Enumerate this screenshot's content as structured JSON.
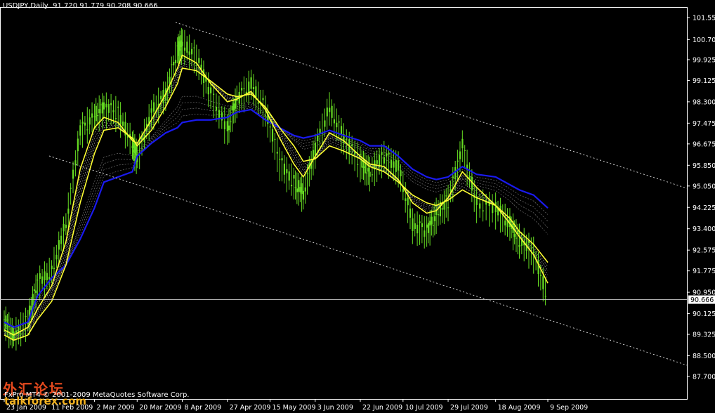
{
  "header": {
    "symbol": "USDJPY,Daily",
    "ohlc": "91.720 91.779 90.208 90.666"
  },
  "footer": {
    "copyright": "FxPro MT4 © 2001-2009 MetaQuotes Software Corp.",
    "watermark_cn": "外汇论坛",
    "watermark_en": "talkforex.com"
  },
  "colors": {
    "background": "#000000",
    "axis": "#ffffff",
    "candles": "#66dd22",
    "ma_yellow": "#ffff33",
    "ma_blue": "#1a1aee",
    "ribbon": "#ffffff"
  },
  "chart_data": {
    "type": "line",
    "title": "USDJPY,Daily",
    "current_price": 90.666,
    "ylim": [
      87.7,
      101.55
    ],
    "y_ticks": [
      101.55,
      100.7,
      99.925,
      99.125,
      98.3,
      97.475,
      96.675,
      95.85,
      95.05,
      94.225,
      93.4,
      92.575,
      91.775,
      90.95,
      90.125,
      89.325,
      88.5,
      87.7
    ],
    "y_tick_labels": [
      "101.550",
      "100.700",
      "99.925",
      "99.125",
      "98.300",
      "97.475",
      "96.675",
      "95.850",
      "95.050",
      "94.225",
      "93.400",
      "92.575",
      "91.775",
      "90.950",
      "90.125",
      "89.325",
      "88.500",
      "87.700"
    ],
    "x_dates": [
      "2009-01-23",
      "2009-01-27",
      "2009-02-02",
      "2009-02-06",
      "2009-02-12",
      "2009-02-18",
      "2009-02-24",
      "2009-03-02",
      "2009-03-06",
      "2009-03-12",
      "2009-03-18",
      "2009-03-20",
      "2009-03-26",
      "2009-04-01",
      "2009-04-06",
      "2009-04-08",
      "2009-04-14",
      "2009-04-20",
      "2009-04-27",
      "2009-05-01",
      "2009-05-07",
      "2009-05-13",
      "2009-05-19",
      "2009-05-25",
      "2009-05-29",
      "2009-06-03",
      "2009-06-09",
      "2009-06-15",
      "2009-06-22",
      "2009-06-26",
      "2009-07-02",
      "2009-07-08",
      "2009-07-14",
      "2009-07-20",
      "2009-07-24",
      "2009-07-29",
      "2009-08-04",
      "2009-08-10",
      "2009-08-18",
      "2009-08-24",
      "2009-08-28",
      "2009-09-03",
      "2009-09-09"
    ],
    "x_tick_labels": [
      "23 Jan 2009",
      "11 Feb 2009",
      "2 Mar 2009",
      "20 Mar 2009",
      "8 Apr 2009",
      "27 Apr 2009",
      "15 May 2009",
      "3 Jun 2009",
      "22 Jun 2009",
      "10 Jul 2009",
      "29 Jul 2009",
      "18 Aug 2009",
      "9 Sep 2009"
    ],
    "series": [
      {
        "key": "close",
        "values": [
          89.9,
          89.3,
          89.9,
          91.3,
          91.8,
          93.6,
          97.2,
          97.8,
          98.1,
          97.9,
          96.7,
          96.2,
          97.9,
          98.6,
          100.3,
          100.6,
          100.0,
          98.6,
          97.3,
          98.4,
          99.0,
          98.0,
          96.0,
          95.2,
          94.8,
          96.5,
          98.1,
          96.9,
          96.0,
          95.6,
          96.2,
          95.8,
          93.6,
          93.3,
          94.0,
          94.5,
          96.6,
          94.4,
          94.2,
          93.6,
          93.0,
          92.5,
          90.7
        ]
      },
      {
        "key": "ma_fast",
        "values": [
          89.5,
          89.3,
          89.6,
          90.3,
          91.2,
          92.9,
          95.7,
          97.3,
          97.7,
          97.5,
          96.8,
          96.7,
          97.6,
          98.6,
          99.6,
          100.1,
          99.8,
          99.0,
          98.3,
          98.4,
          98.7,
          98.0,
          96.9,
          95.9,
          95.4,
          96.2,
          97.1,
          96.8,
          96.2,
          95.9,
          95.8,
          95.3,
          94.4,
          94.0,
          94.1,
          94.6,
          95.6,
          95.0,
          94.3,
          93.6,
          93.1,
          92.4,
          91.3
        ]
      },
      {
        "key": "ma_mid",
        "values": [
          89.3,
          89.1,
          89.3,
          89.9,
          90.6,
          92.0,
          94.4,
          96.3,
          97.2,
          97.3,
          96.9,
          96.6,
          97.2,
          98.1,
          99.0,
          99.6,
          99.5,
          99.1,
          98.6,
          98.5,
          98.6,
          98.1,
          97.3,
          96.6,
          96.0,
          96.1,
          96.6,
          96.4,
          96.1,
          95.8,
          95.6,
          95.2,
          94.7,
          94.4,
          94.3,
          94.5,
          94.9,
          94.6,
          94.3,
          93.8,
          93.3,
          92.8,
          92.1
        ]
      },
      {
        "key": "ma_blue_slow",
        "values": [
          89.8,
          89.6,
          89.8,
          90.8,
          91.5,
          92.0,
          93.0,
          94.2,
          95.2,
          95.4,
          95.6,
          96.2,
          96.7,
          97.1,
          97.3,
          97.5,
          97.6,
          97.6,
          97.7,
          97.9,
          98.0,
          97.6,
          97.3,
          97.0,
          96.9,
          97.0,
          97.2,
          97.0,
          96.8,
          96.6,
          96.6,
          96.2,
          95.7,
          95.4,
          95.3,
          95.4,
          95.8,
          95.5,
          95.4,
          95.1,
          94.9,
          94.7,
          94.2
        ]
      }
    ]
  }
}
